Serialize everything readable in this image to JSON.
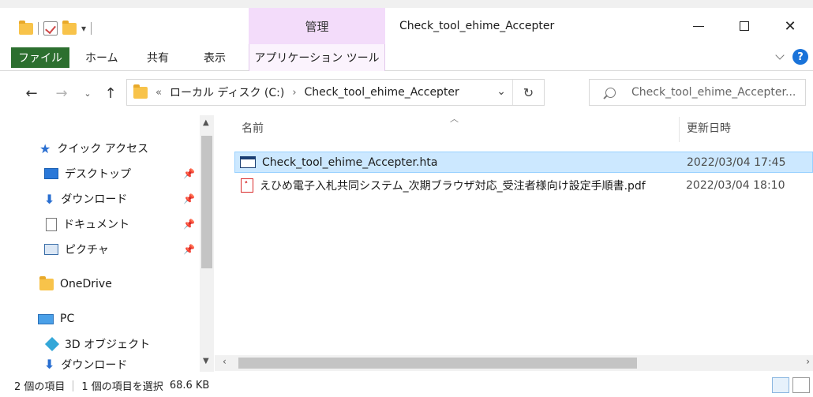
{
  "window": {
    "title": "Check_tool_ehime_Accepter",
    "context_tab": "管理",
    "controls": {
      "minimize": "—",
      "maximize": "☐",
      "close": "✕"
    }
  },
  "ribbon": {
    "tabs": [
      "ファイル",
      "ホーム",
      "共有",
      "表示"
    ],
    "context_tab": "アプリケーション ツール",
    "help": "?"
  },
  "address": {
    "overflow": "«",
    "crumbs": [
      "ローカル ディスク (C:)",
      "Check_tool_ehime_Accepter"
    ],
    "separator": "›"
  },
  "search": {
    "placeholder": "Check_tool_ehime_Accepter..."
  },
  "nav": {
    "quick_access": "クイック アクセス",
    "items": [
      "デスクトップ",
      "ダウンロード",
      "ドキュメント",
      "ピクチャ"
    ],
    "onedrive": "OneDrive",
    "pc": "PC",
    "pc_items": [
      "3D オブジェクト",
      "ダウンロード"
    ]
  },
  "columns": {
    "name": "名前",
    "modified": "更新日時"
  },
  "files": [
    {
      "name": "Check_tool_ehime_Accepter.hta",
      "modified": "2022/03/04 17:45",
      "type": "hta",
      "selected": true
    },
    {
      "name": "えひめ電子入札共同システム_次期ブラウザ対応_受注者様向け設定手順書.pdf",
      "modified": "2022/03/04 18:10",
      "type": "pdf",
      "selected": false
    }
  ],
  "status": {
    "count": "2 個の項目",
    "selected": "1 個の項目を選択",
    "size": "68.6 KB"
  },
  "colors": {
    "file_tab": "#2c6f2f",
    "selection": "#cce8ff",
    "manage_tab": "#f3dcfa"
  }
}
